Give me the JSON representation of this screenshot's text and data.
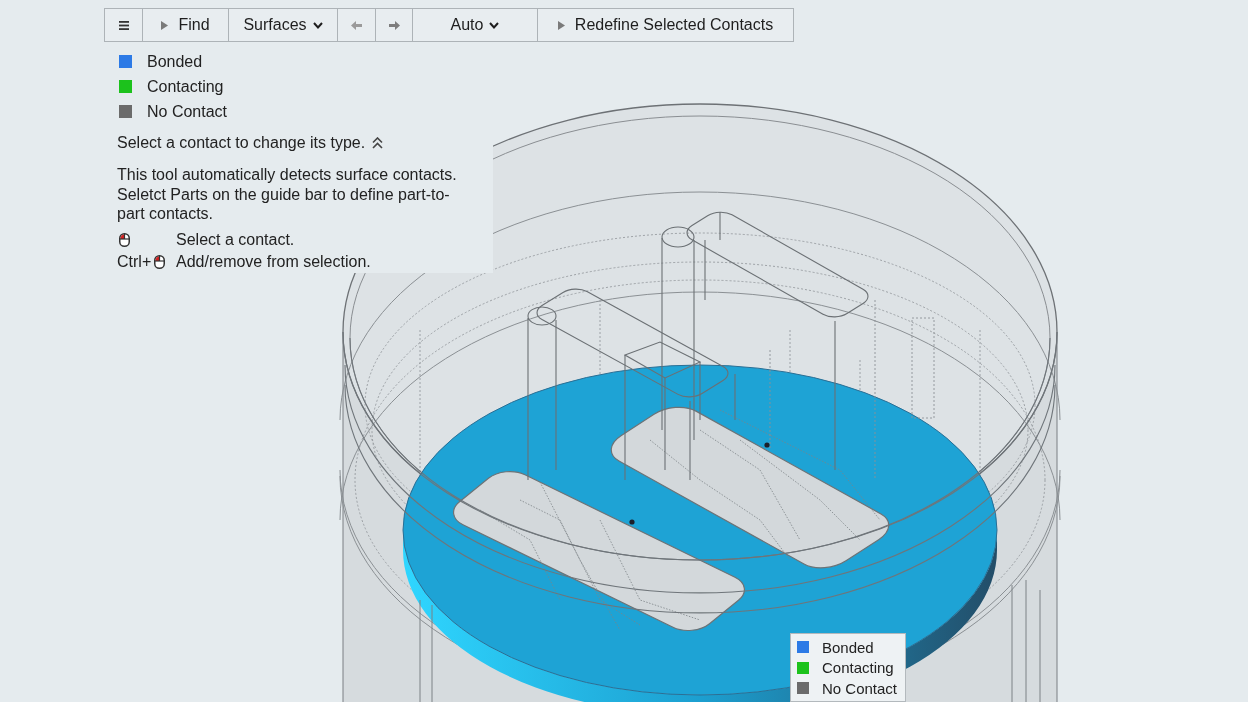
{
  "toolbar": [
    {
      "kind": "menu"
    },
    {
      "kind": "run",
      "label": "Find"
    },
    {
      "kind": "dropdown",
      "label": "Surfaces"
    },
    {
      "kind": "back"
    },
    {
      "kind": "forward"
    },
    {
      "kind": "dropdown",
      "label": "Auto"
    },
    {
      "kind": "run",
      "label": "Redefine Selected Contacts"
    }
  ],
  "legend": [
    {
      "label": "Bonded",
      "color": "#2c7ae6"
    },
    {
      "label": "Contacting",
      "color": "#1cc21c"
    },
    {
      "label": "No Contact",
      "color": "#6b6b6b"
    }
  ],
  "help": {
    "prompt": "Select a contact to change its type.",
    "expanded": true,
    "description": "This tool automatically detects surface contacts. Seletct Parts on the guide bar to define part-to-part contacts.",
    "shortcuts": [
      {
        "action": "Select a contact."
      },
      {
        "modifier": "Ctrl+",
        "action": "Add/remove from selection."
      }
    ]
  },
  "viewport_legend": [
    {
      "label": "Bonded",
      "color": "#2c7ae6"
    },
    {
      "label": "Contacting",
      "color": "#1cc21c"
    },
    {
      "label": "No Contact",
      "color": "#6b6b6b"
    }
  ]
}
